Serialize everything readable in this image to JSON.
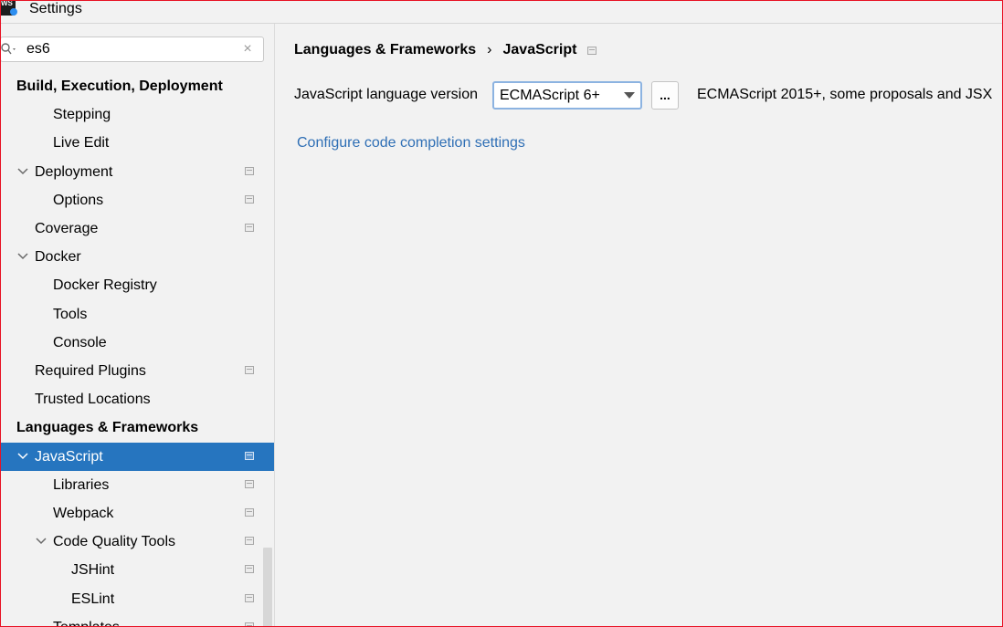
{
  "window": {
    "title": "Settings",
    "app_icon_text": "WS"
  },
  "search": {
    "value": "es6",
    "clear_glyph": "×"
  },
  "tree": {
    "items": [
      {
        "label": "Build, Execution, Deployment",
        "bold": true,
        "depth": 0,
        "chevron": false,
        "page_icon": false
      },
      {
        "label": "Stepping",
        "depth": 2,
        "chevron": false,
        "page_icon": false
      },
      {
        "label": "Live Edit",
        "depth": 2,
        "chevron": false,
        "page_icon": false
      },
      {
        "label": "Deployment",
        "depth": 1,
        "chevron": true,
        "page_icon": true
      },
      {
        "label": "Options",
        "depth": 2,
        "chevron": false,
        "page_icon": true
      },
      {
        "label": "Coverage",
        "depth": 1,
        "chevron": false,
        "page_icon": true
      },
      {
        "label": "Docker",
        "depth": 1,
        "chevron": true,
        "page_icon": false
      },
      {
        "label": "Docker Registry",
        "depth": 2,
        "chevron": false,
        "page_icon": false
      },
      {
        "label": "Tools",
        "depth": 2,
        "chevron": false,
        "page_icon": false
      },
      {
        "label": "Console",
        "depth": 2,
        "chevron": false,
        "page_icon": false
      },
      {
        "label": "Required Plugins",
        "depth": 1,
        "chevron": false,
        "page_icon": true
      },
      {
        "label": "Trusted Locations",
        "depth": 1,
        "chevron": false,
        "page_icon": false
      },
      {
        "label": "Languages & Frameworks",
        "bold": true,
        "depth": 0,
        "chevron": false,
        "page_icon": false
      },
      {
        "label": "JavaScript",
        "depth": 1,
        "chevron": true,
        "page_icon": true,
        "selected": true
      },
      {
        "label": "Libraries",
        "depth": 2,
        "chevron": false,
        "page_icon": true
      },
      {
        "label": "Webpack",
        "depth": 2,
        "chevron": false,
        "page_icon": true
      },
      {
        "label": "Code Quality Tools",
        "depth": 2,
        "chevron": true,
        "page_icon": true
      },
      {
        "label": "JSHint",
        "depth": 3,
        "chevron": false,
        "page_icon": true
      },
      {
        "label": "ESLint",
        "depth": 3,
        "chevron": false,
        "page_icon": true
      },
      {
        "label": "Templates",
        "depth": 2,
        "chevron": false,
        "page_icon": true
      }
    ]
  },
  "main": {
    "breadcrumb": {
      "parent": "Languages & Frameworks",
      "separator": "›",
      "current": "JavaScript"
    },
    "language_version": {
      "label": "JavaScript language version",
      "selected": "ECMAScript 6+",
      "dots_label": "...",
      "description": "ECMAScript 2015+, some proposals and JSX"
    },
    "configure_link": "Configure code completion settings"
  },
  "colors": {
    "selection": "#2675bf",
    "link": "#2f6fb5",
    "window_border": "#e81123"
  }
}
